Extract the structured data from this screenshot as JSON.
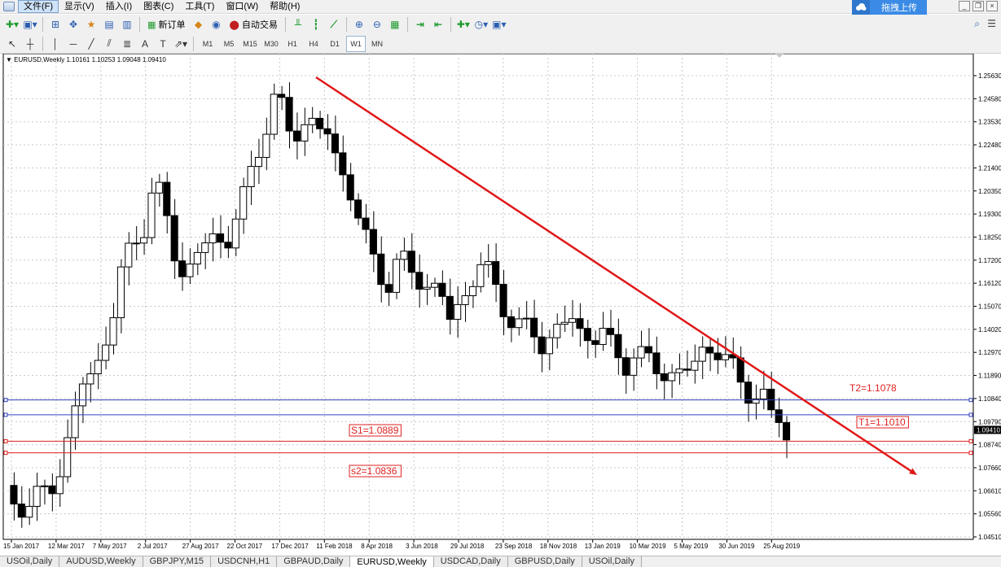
{
  "menu": {
    "items": [
      "文件(F)",
      "显示(V)",
      "插入(I)",
      "图表(C)",
      "工具(T)",
      "窗口(W)",
      "帮助(H)"
    ],
    "active_index": 0
  },
  "upload_button": {
    "label": "拖拽上传",
    "icon": "cloud-icon"
  },
  "window_controls": [
    "minimize-icon",
    "restore-icon",
    "close-icon"
  ],
  "toolbar1": {
    "new_order_label": "新订单",
    "auto_trading_label": "自动交易"
  },
  "toolbar2": {
    "timeframes": [
      "M1",
      "M5",
      "M15",
      "M30",
      "H1",
      "H4",
      "D1",
      "W1",
      "MN"
    ],
    "active_timeframe": "W1"
  },
  "chart": {
    "info_label": "EURUSD,Weekly  1.10161 1.10253 1.09048 1.09410",
    "current_price": "1.09410",
    "price_ticks": [
      "1.25630",
      "1.24580",
      "1.23530",
      "1.22480",
      "1.21400",
      "1.20350",
      "1.19300",
      "1.18250",
      "1.17200",
      "1.16120",
      "1.15070",
      "1.14020",
      "1.12970",
      "1.11890",
      "1.10840",
      "1.09790",
      "1.08740",
      "1.07660",
      "1.06610",
      "1.05560",
      "1.04510"
    ],
    "date_ticks": [
      "15 Jan 2017",
      "12 Mar 2017",
      "7 May 2017",
      "2 Jul 2017",
      "27 Aug 2017",
      "22 Oct 2017",
      "17 Dec 2017",
      "11 Feb 2018",
      "8 Apr 2018",
      "3 Jun 2018",
      "29 Jul 2018",
      "23 Sep 2018",
      "18 Nov 2018",
      "13 Jan 2019",
      "10 Mar 2019",
      "5 May 2019",
      "30 Jun 2019",
      "25 Aug 2019"
    ],
    "labels": {
      "t2": "T2=1.1078",
      "t1": "T1=1.1010",
      "s1": "S1=1.0889",
      "s2": "s2=1.0836"
    },
    "colors": {
      "trendline": "#e01818",
      "support": "#e02020",
      "resistance": "#3040c0",
      "bull": "#ffffff",
      "bear": "#000000"
    }
  },
  "tabs": {
    "items": [
      "USOil,Daily",
      "AUDUSD,Weekly",
      "GBPJPY,M15",
      "USDCNH,H1",
      "GBPAUD,Daily",
      "EURUSD,Weekly",
      "USDCAD,Daily",
      "GBPUSD,Daily",
      "USOil,Daily"
    ],
    "active_index": 5
  }
}
